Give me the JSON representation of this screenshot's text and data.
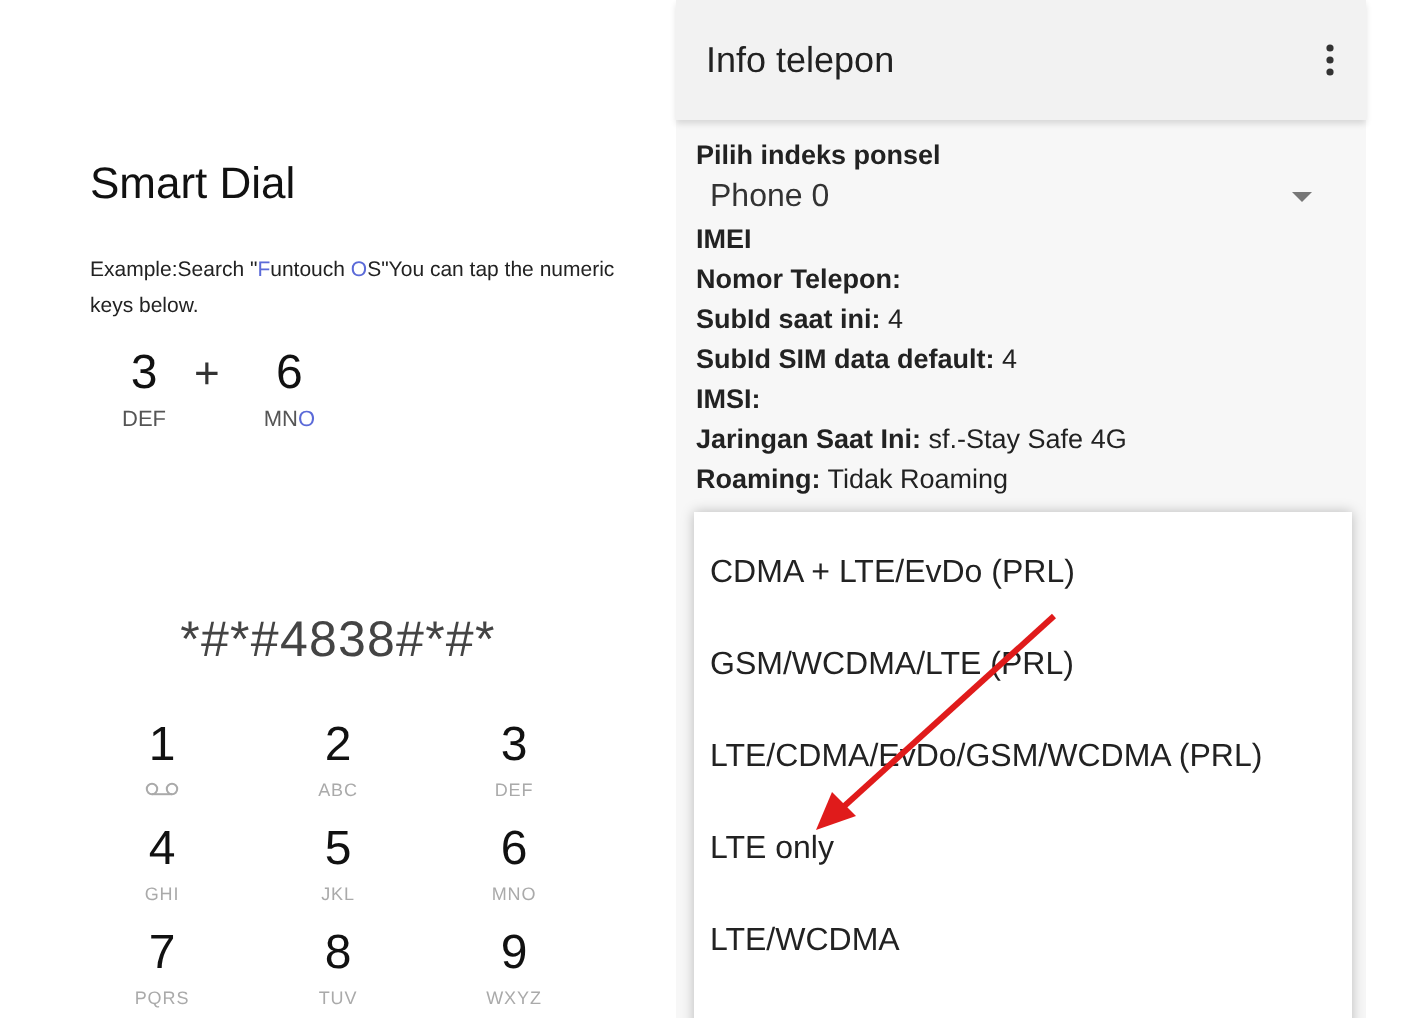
{
  "smart_dial": {
    "title": "Smart Dial",
    "example": [
      {
        "text": "Example:Search \"",
        "accent": false
      },
      {
        "text": "F",
        "accent": true
      },
      {
        "text": "untouch ",
        "accent": false
      },
      {
        "text": "O",
        "accent": true
      },
      {
        "text": "S\"You can tap the numeric keys below.",
        "accent": false
      }
    ],
    "combo": [
      {
        "digit": "3",
        "letters": [
          {
            "text": "DEF",
            "accent": false
          }
        ]
      },
      {
        "digit": "6",
        "letters": [
          {
            "text": "MN",
            "accent": false
          },
          {
            "text": "O",
            "accent": true
          }
        ]
      }
    ],
    "plus": "+"
  },
  "dialer": {
    "number": "*#*#4838#*#*",
    "keys": [
      {
        "digit": "1",
        "kind": "voicemail"
      },
      {
        "digit": "2",
        "sub": "ABC"
      },
      {
        "digit": "3",
        "sub": "DEF"
      },
      {
        "digit": "4",
        "sub": "GHI"
      },
      {
        "digit": "5",
        "sub": "JKL"
      },
      {
        "digit": "6",
        "sub": "MNO"
      },
      {
        "digit": "7",
        "sub": "PQRS"
      },
      {
        "digit": "8",
        "sub": "TUV"
      },
      {
        "digit": "9",
        "sub": "WXYZ"
      }
    ]
  },
  "phone_info": {
    "title": "Info telepon",
    "phone_index": {
      "label": "Pilih indeks ponsel",
      "value": "Phone 0"
    },
    "fields": [
      {
        "label": "IMEI"
      },
      {
        "label": "Nomor Telepon:"
      },
      {
        "label": "SubId saat ini:",
        "value": "4"
      },
      {
        "label": "SubId SIM data default:",
        "value": "4"
      },
      {
        "label": "IMSI:"
      },
      {
        "label": "Jaringan Saat Ini:",
        "value": "sf.-Stay Safe 4G"
      },
      {
        "label": "Roaming:",
        "value": "Tidak Roaming"
      }
    ],
    "network_menu": [
      "CDMA + LTE/EvDo (PRL)",
      "GSM/WCDMA/LTE (PRL)",
      "LTE/CDMA/EvDo/GSM/WCDMA (PRL)",
      "LTE only",
      "LTE/WCDMA"
    ]
  }
}
